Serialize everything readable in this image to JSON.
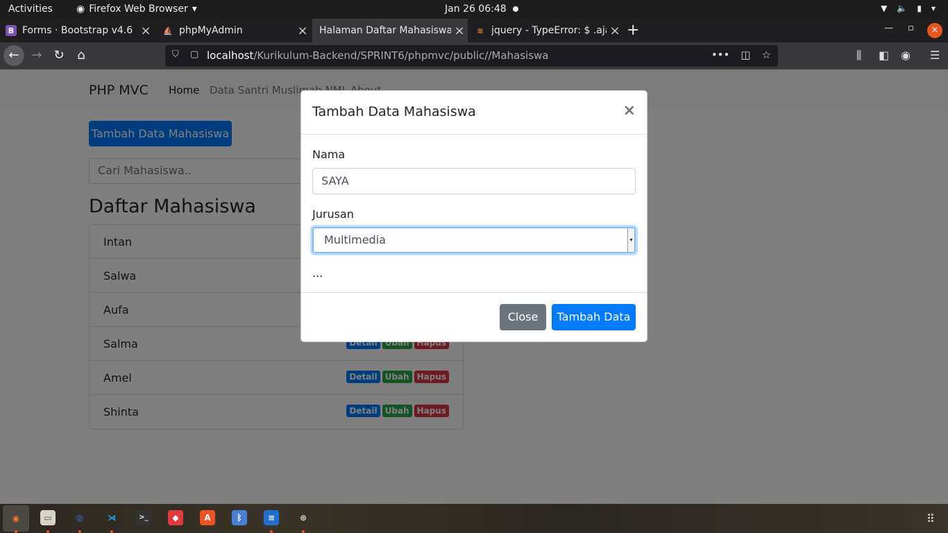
{
  "system_bar": {
    "activities": "Activities",
    "app_name": "Firefox Web Browser",
    "clock": "Jan 26  06:48"
  },
  "browser": {
    "tabs": [
      {
        "label": "Forms · Bootstrap v4.6",
        "favicon": "bootstrap-icon",
        "active": false
      },
      {
        "label": "phpMyAdmin",
        "favicon": "phpmyadmin-icon",
        "active": false
      },
      {
        "label": "Halaman Daftar Mahasiswa",
        "favicon": "",
        "active": true
      },
      {
        "label": "jquery - TypeError: $ .ajax",
        "favicon": "stackoverflow-icon",
        "active": false
      }
    ],
    "url_host": "localhost",
    "url_path": "/Kurikulum-Backend/SPRINT6/phpmvc/public//Mahasiswa"
  },
  "site": {
    "brand": "PHP MVC",
    "nav": [
      "Home",
      "Data Santri Muslimah NML",
      "About"
    ],
    "add_button": "Tambah Data Mahasiswa",
    "search_placeholder": "Cari Mahasiswa..",
    "heading": "Daftar Mahasiswa",
    "students": [
      "Intan",
      "Salwa",
      "Aufa",
      "Salma",
      "Amel",
      "Shinta"
    ],
    "badges": {
      "detail": "Detail",
      "edit": "Ubah",
      "delete": "Hapus"
    }
  },
  "modal": {
    "title": "Tambah Data Mahasiswa",
    "close_symbol": "×",
    "name_label": "Nama",
    "name_value": "SAYA",
    "major_label": "Jurusan",
    "major_value": "Multimedia",
    "ellipsis": "...",
    "close_button": "Close",
    "submit_button": "Tambah Data"
  },
  "colors": {
    "primary": "#007bff",
    "secondary": "#6c757d",
    "success": "#28a745",
    "danger": "#dc3545",
    "ubuntu_orange": "#e95420"
  }
}
